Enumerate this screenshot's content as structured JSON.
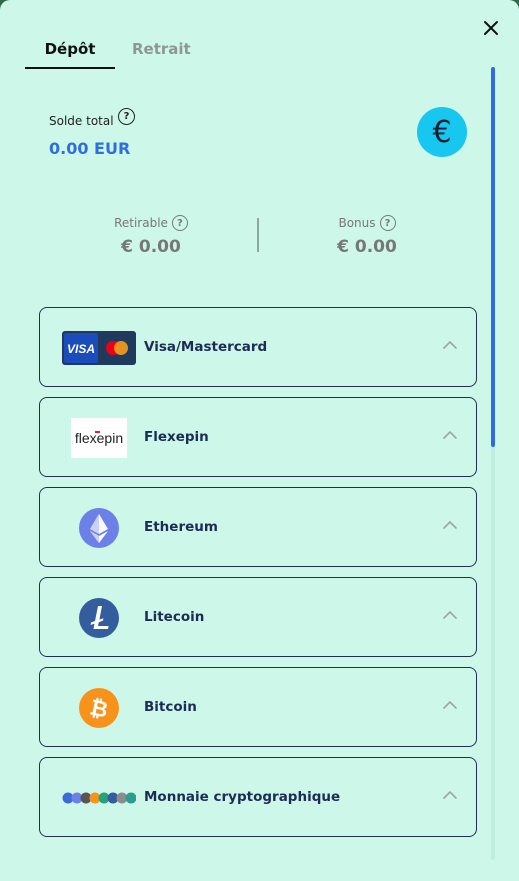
{
  "tabs": [
    {
      "label": "Dépôt",
      "active": true
    },
    {
      "label": "Retrait",
      "active": false
    }
  ],
  "balance": {
    "label": "Solde total",
    "value": "0.00 EUR",
    "currency_symbol": "€"
  },
  "withdrawable": {
    "label": "Retirable",
    "value": "€ 0.00"
  },
  "bonus": {
    "label": "Bonus",
    "value": "€ 0.00"
  },
  "payment_methods": [
    {
      "name": "Visa/Mastercard",
      "icon": "visa-mastercard-logo"
    },
    {
      "name": "Flexepin",
      "icon": "flexepin-logo"
    },
    {
      "name": "Ethereum",
      "icon": "ethereum-icon"
    },
    {
      "name": "Litecoin",
      "icon": "litecoin-icon"
    },
    {
      "name": "Bitcoin",
      "icon": "bitcoin-icon"
    },
    {
      "name": "Monnaie cryptographique",
      "icon": "crypto-coins-icon"
    }
  ],
  "logo_text": {
    "visa": "VISA",
    "flexepin": "flexepin"
  },
  "colors": {
    "background": "#cdf8e9",
    "accent_blue": "#2d6fe0",
    "currency_badge": "#17c7f0",
    "border": "#1f2f52"
  }
}
